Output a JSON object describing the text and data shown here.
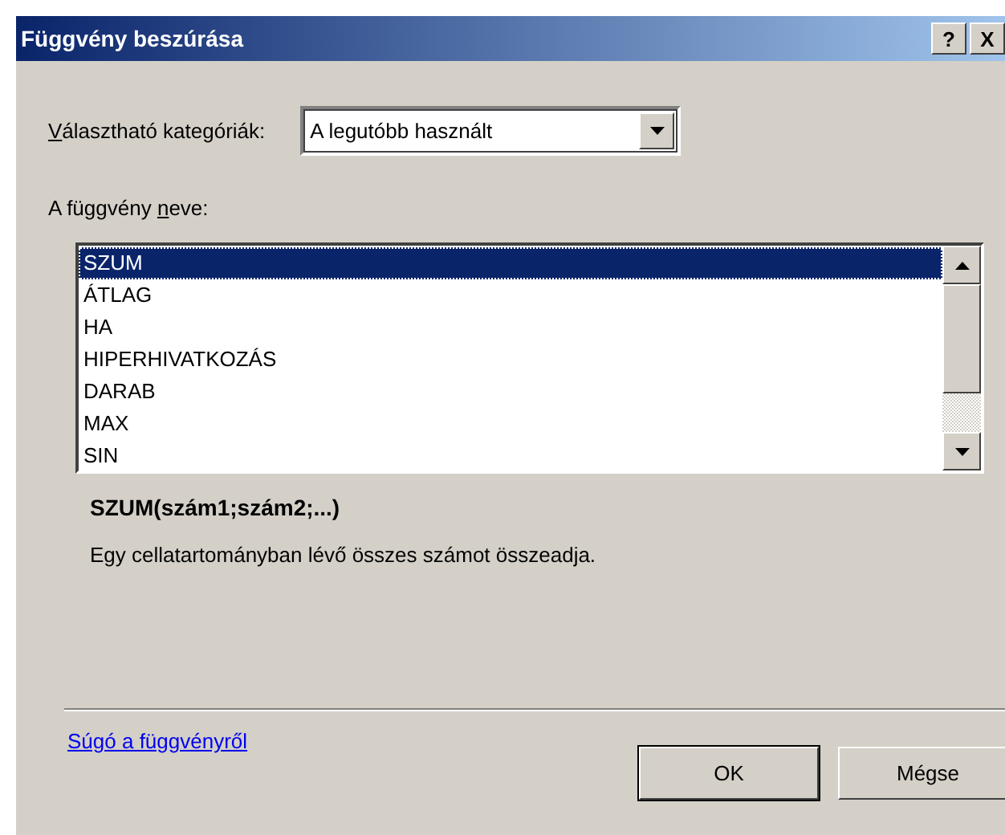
{
  "window": {
    "title": "Függvény beszúrása",
    "title_buttons": [
      "?",
      "X"
    ]
  },
  "category": {
    "label": {
      "key": "V",
      "post": "álasztható kategóriák:"
    },
    "value": "A legutóbb használt"
  },
  "function_list": {
    "label": {
      "pre": "A függvény ",
      "key": "n",
      "post": "eve:"
    },
    "items": [
      {
        "name": "SZUM",
        "selected": true
      },
      {
        "name": "ÁTLAG",
        "selected": false
      },
      {
        "name": "HA",
        "selected": false
      },
      {
        "name": "HIPERHIVATKOZÁS",
        "selected": false
      },
      {
        "name": "DARAB",
        "selected": false
      },
      {
        "name": "MAX",
        "selected": false
      },
      {
        "name": "SIN",
        "selected": false
      }
    ]
  },
  "signature": "SZUM(szám1;szám2;...)",
  "description": "Egy cellatartományban lévő összes számot összeadja.",
  "help_link": "Súgó a függvényről",
  "buttons": [
    "OK",
    "Mégse"
  ]
}
